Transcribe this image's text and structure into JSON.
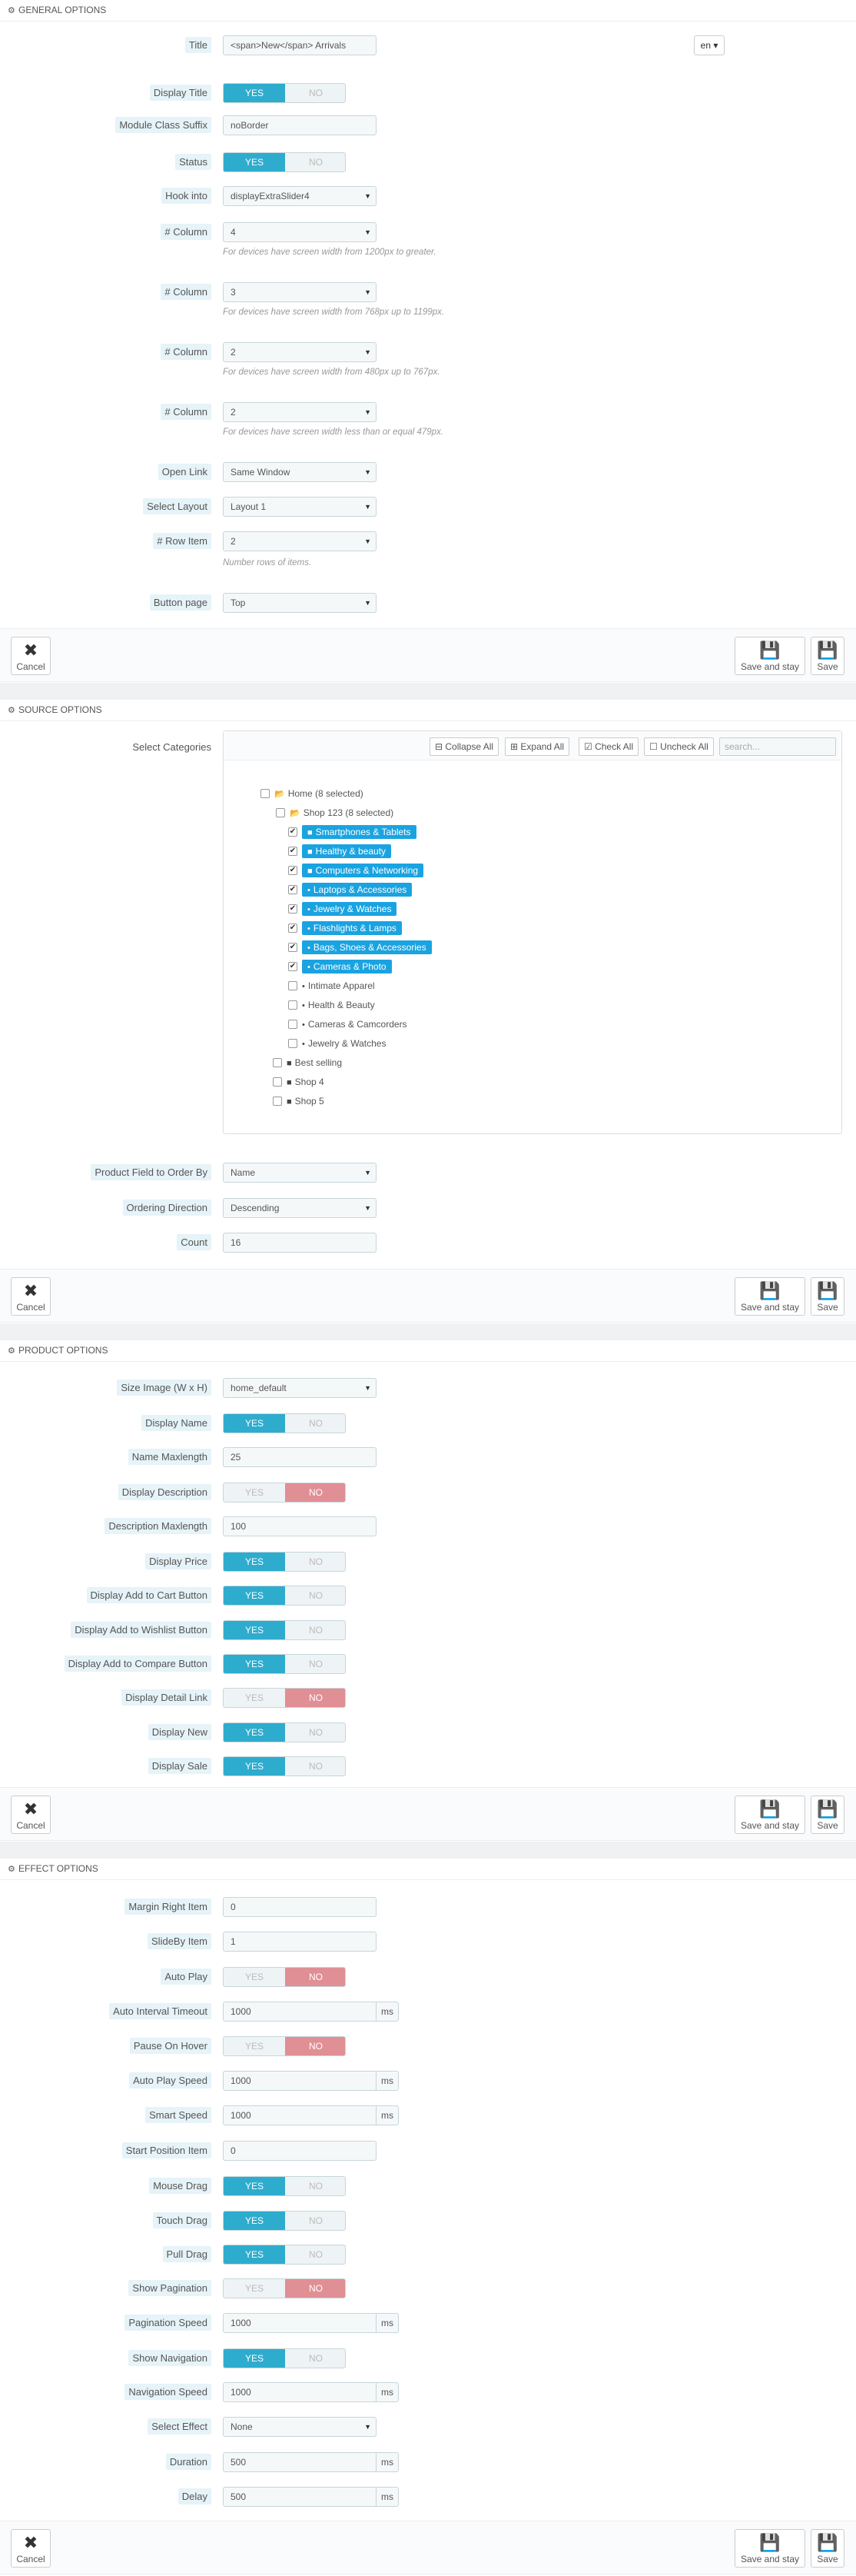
{
  "general": {
    "header": "GENERAL OPTIONS",
    "title_label": "Title",
    "title_value": "<span>New</span> Arrivals",
    "lang": "en ▾",
    "display_title_label": "Display Title",
    "display_title": "YES",
    "module_class_label": "Module Class Suffix",
    "module_class_value": "noBorder",
    "status_label": "Status",
    "hook_label": "Hook into",
    "hook_value": "displayExtraSlider4",
    "col_label": "# Column",
    "col1_value": "4",
    "col1_help": "For devices have screen width from 1200px to greater.",
    "col2_value": "3",
    "col2_help": "For devices have screen width from 768px up to 1199px.",
    "col3_value": "2",
    "col3_help": "For devices have screen width from 480px up to 767px.",
    "col4_value": "2",
    "col4_help": "For devices have screen width less than or equal 479px.",
    "open_link_label": "Open Link",
    "open_link_value": "Same Window",
    "layout_label": "Select Layout",
    "layout_value": "Layout 1",
    "row_item_label": "# Row Item",
    "row_item_value": "2",
    "row_item_help": "Number rows of items.",
    "button_page_label": "Button page",
    "button_page_value": "Top"
  },
  "switch": {
    "yes": "YES",
    "no": "NO"
  },
  "footer": {
    "cancel": "Cancel",
    "save_stay": "Save and stay",
    "save": "Save"
  },
  "source": {
    "header": "SOURCE OPTIONS",
    "select_categories_label": "Select Categories",
    "collapse_all": "Collapse All",
    "expand_all": "Expand All",
    "check_all": "Check All",
    "uncheck_all": "Uncheck All",
    "search_placeholder": "search...",
    "tree": {
      "home": "Home (8 selected)",
      "shop123": "Shop 123 (8 selected)",
      "cats": [
        "Smartphones & Tablets",
        "Healthy & beauty",
        "Computers & Networking",
        "Laptops & Accessories",
        "Jewelry & Watches",
        "Flashlights & Lamps",
        "Bags, Shoes & Accessories",
        "Cameras & Photo"
      ],
      "unchecked": [
        "Intimate Apparel",
        "Health & Beauty",
        "Cameras & Camcorders",
        "Jewelry & Watches"
      ],
      "others": [
        "Best selling",
        "Shop 4",
        "Shop 5"
      ]
    },
    "order_field_label": "Product Field to Order By",
    "order_field_value": "Name",
    "order_dir_label": "Ordering Direction",
    "order_dir_value": "Descending",
    "count_label": "Count",
    "count_value": "16"
  },
  "product": {
    "header": "PRODUCT OPTIONS",
    "size_label": "Size Image (W x H)",
    "size_value": "home_default",
    "display_name_label": "Display Name",
    "name_max_label": "Name Maxlength",
    "name_max_value": "25",
    "display_desc_label": "Display Description",
    "desc_max_label": "Description Maxlength",
    "desc_max_value": "100",
    "display_price_label": "Display Price",
    "cart_label": "Display Add to Cart Button",
    "wishlist_label": "Display Add to Wishlist Button",
    "compare_label": "Display Add to Compare Button",
    "detail_label": "Display Detail Link",
    "new_label": "Display New",
    "sale_label": "Display Sale"
  },
  "effect": {
    "header": "EFFECT OPTIONS",
    "margin_label": "Margin Right Item",
    "margin_value": "0",
    "slideby_label": "SlideBy Item",
    "slideby_value": "1",
    "autoplay_label": "Auto Play",
    "auto_interval_label": "Auto Interval Timeout",
    "auto_interval_value": "1000",
    "pause_label": "Pause On Hover",
    "autoplay_speed_label": "Auto Play Speed",
    "autoplay_speed_value": "1000",
    "smart_speed_label": "Smart Speed",
    "smart_speed_value": "1000",
    "start_pos_label": "Start Position Item",
    "start_pos_value": "0",
    "mouse_drag_label": "Mouse Drag",
    "touch_drag_label": "Touch Drag",
    "pull_drag_label": "Pull Drag",
    "show_pag_label": "Show Pagination",
    "pag_speed_label": "Pagination Speed",
    "pag_speed_value": "1000",
    "show_nav_label": "Show Navigation",
    "nav_speed_label": "Navigation Speed",
    "nav_speed_value": "1000",
    "select_effect_label": "Select Effect",
    "select_effect_value": "None",
    "duration_label": "Duration",
    "duration_value": "500",
    "delay_label": "Delay",
    "delay_value": "500",
    "ms": "ms"
  }
}
